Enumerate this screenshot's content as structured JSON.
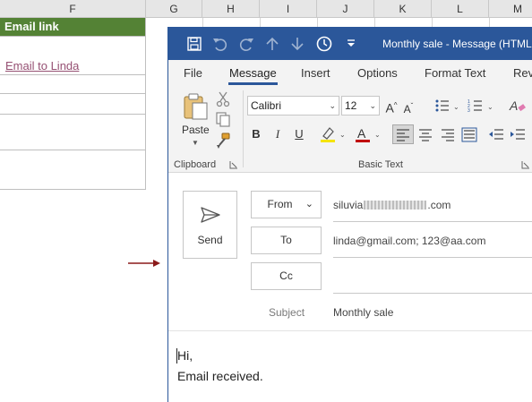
{
  "excel": {
    "columns": [
      "F",
      "G",
      "H",
      "I",
      "J",
      "K",
      "L",
      "M"
    ],
    "header_cell": "Email link",
    "link_cell": "Email to Linda",
    "link_color": "#954f72",
    "header_bg": "#548235"
  },
  "outlook": {
    "window_title": "Monthly sale  -  Message (HTML",
    "accent": "#2b579a",
    "tabs": [
      {
        "label": "File"
      },
      {
        "label": "Message"
      },
      {
        "label": "Insert"
      },
      {
        "label": "Options"
      },
      {
        "label": "Format Text"
      },
      {
        "label": "Rev"
      }
    ],
    "active_tab": "Message",
    "ribbon": {
      "clipboard_group": "Clipboard",
      "basic_text_group": "Basic Text",
      "paste_label": "Paste",
      "font_name": "Calibri",
      "font_size": "12",
      "bold": "B",
      "italic": "I",
      "underline": "U"
    },
    "compose": {
      "send_label": "Send",
      "from_label": "From",
      "to_label": "To",
      "cc_label": "Cc",
      "subject_label": "Subject",
      "from_value_prefix": "siluvia",
      "from_value_suffix": ".com",
      "to_value": "linda@gmail.com; 123@aa.com",
      "subject_value": "Monthly sale",
      "body_line1": "Hi,",
      "body_line2": "Email received."
    }
  },
  "annotation": {
    "arrow_color": "#8b1a1a"
  }
}
